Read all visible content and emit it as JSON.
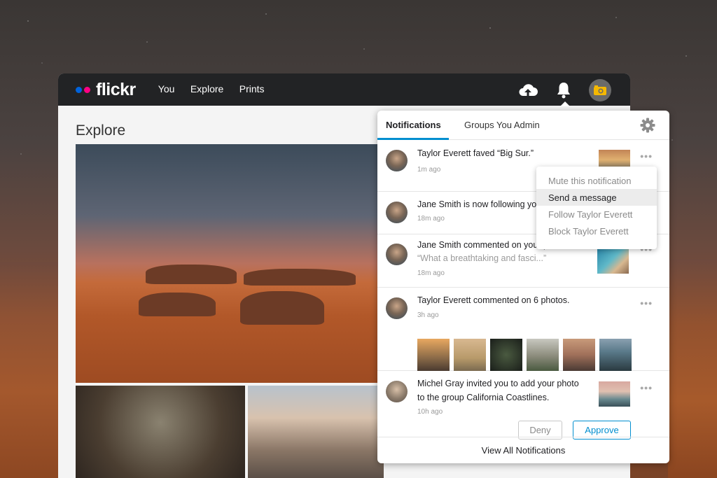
{
  "brand": {
    "name": "flickr",
    "colors": {
      "blue": "#0063dc",
      "pink": "#ff0084",
      "accent": "#008ecf"
    }
  },
  "nav": {
    "items": [
      {
        "label": "You"
      },
      {
        "label": "Explore"
      },
      {
        "label": "Prints"
      }
    ]
  },
  "header_icons": [
    "upload-cloud-icon",
    "bell-icon",
    "camera-avatar-icon"
  ],
  "page": {
    "title": "Explore"
  },
  "notifications": {
    "tabs": [
      {
        "label": "Notifications",
        "active": true
      },
      {
        "label": "Groups You Admin",
        "active": false
      }
    ],
    "items": [
      {
        "text": "Taylor Everett faved “Big Sur.”",
        "time": "1m ago"
      },
      {
        "text": "Jane Smith is now following you",
        "time": "18m ago"
      },
      {
        "text": "Jane Smith commented on your photo",
        "quote": "“What a breathtaking and fasci...”",
        "time": "18m ago"
      },
      {
        "text": "Taylor Everett  commented on 6 photos.",
        "time": "3h ago"
      },
      {
        "text_line1": "Michel Gray invited you to add your photo",
        "text_line2": "to the group California Coastlines.",
        "time": "10h ago",
        "deny_label": "Deny",
        "approve_label": "Approve"
      }
    ],
    "view_all_label": "View All Notifications"
  },
  "context_menu": {
    "items": [
      {
        "label": "Mute this notification"
      },
      {
        "label": "Send a message",
        "highlighted": true
      },
      {
        "label": "Follow Taylor Everett"
      },
      {
        "label": "Block Taylor Everett"
      }
    ]
  }
}
